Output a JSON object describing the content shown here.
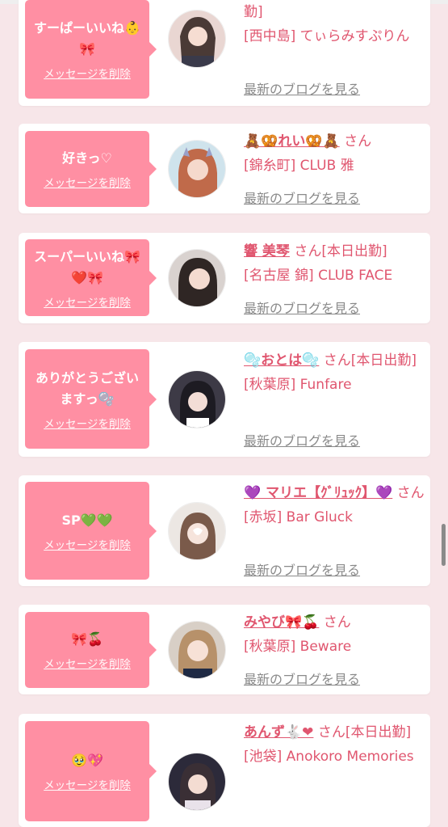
{
  "common": {
    "delete_label": "メッセージを削除",
    "blog_label": "最新のブログを見る"
  },
  "cards": [
    {
      "message": "すーぱーいいね👶🎀",
      "line1": "勤]",
      "line2": "[西中島] てぃらみすぷりん",
      "avatar": "avatar-1"
    },
    {
      "message": "好きっ♡",
      "name": "🧸🥨れい🥨🧸",
      "san": " さん",
      "line2": "[錦糸町] CLUB 雅",
      "avatar": "avatar-2"
    },
    {
      "message": "スーパーいいね🎀❤️🎀",
      "name": "響 美琴",
      "san": " さん[本日出勤]",
      "line2": "[名古屋 錦] CLUB FACE",
      "avatar": "avatar-3"
    },
    {
      "message": "ありがとうございますっ🫧",
      "name": "🫧おとは🫧",
      "san": " さん[本日出勤]",
      "line2": "[秋葉原] Funfare",
      "avatar": "avatar-4"
    },
    {
      "message": "SP💚💚",
      "name": "💜 マリエ【ｸﾞﾘｭｯｸ】💜",
      "san": " さん",
      "line2": "[赤坂] Bar Gluck",
      "avatar": "avatar-5"
    },
    {
      "message": "🎀🍒",
      "name": "みやび🎀🍒",
      "san": " さん",
      "line2": "[秋葉原] Beware",
      "avatar": "avatar-6"
    },
    {
      "message": "🥹💖",
      "name": "あんず🐇❤",
      "san": " さん[本日出勤]",
      "line2": "[池袋] Anokoro Memories",
      "avatar": "avatar-7"
    }
  ],
  "colors": {
    "bubble": "#ff8fa3",
    "link": "#e0566f",
    "background": "#f7e6e9"
  }
}
